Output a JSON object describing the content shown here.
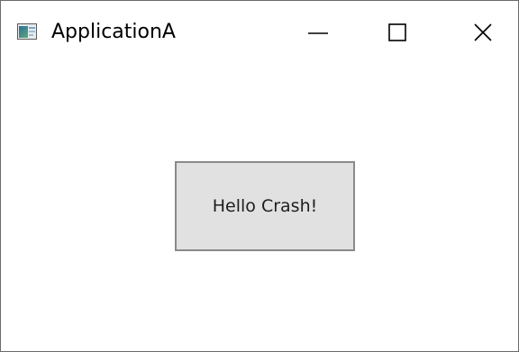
{
  "window": {
    "title": "ApplicationA",
    "app_icon": "application-icon",
    "controls": {
      "minimize_icon": "minimize-icon",
      "maximize_icon": "maximize-icon",
      "close_icon": "close-icon"
    }
  },
  "main": {
    "button_label": "Hello Crash!"
  },
  "colors": {
    "window_border": "#6b6b6b",
    "button_bg": "#e1e1e1",
    "button_border": "#8a8a8a",
    "text": "#000000"
  }
}
